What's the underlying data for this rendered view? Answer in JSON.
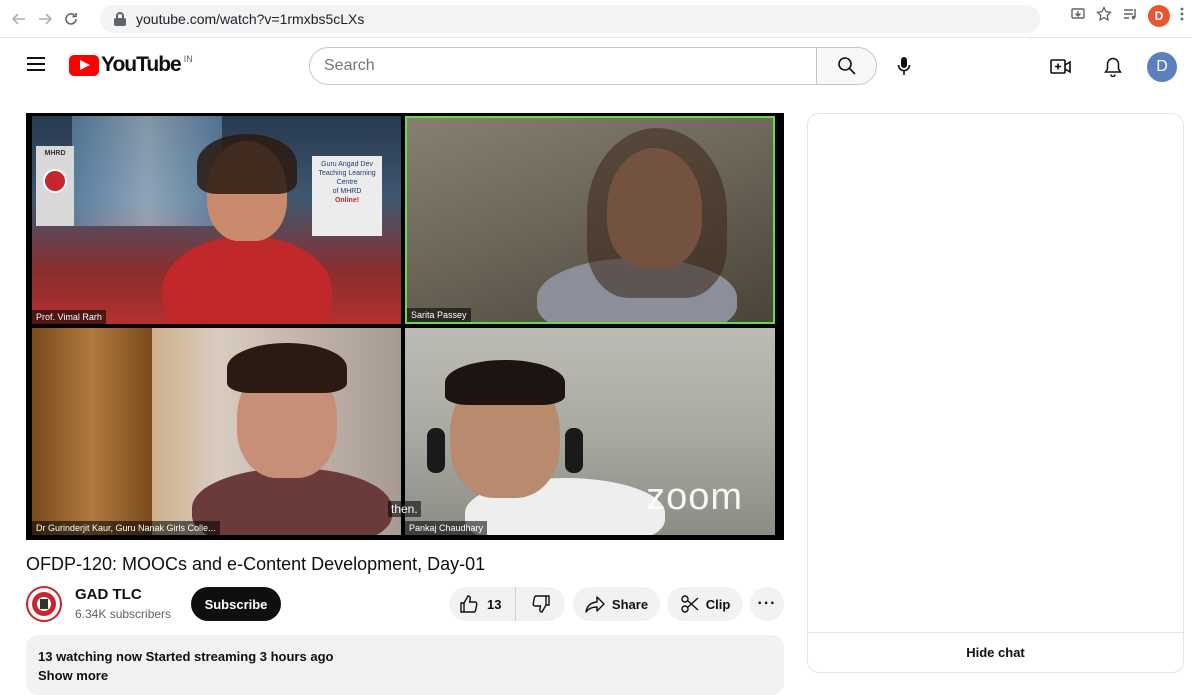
{
  "browser": {
    "url": "youtube.com/watch?v=1rmxbs5cLXs",
    "profile_initial": "D"
  },
  "header": {
    "logo_text": "YouTube",
    "country": "IN",
    "search_placeholder": "Search",
    "avatar_initial": "D"
  },
  "video": {
    "participants": [
      "Prof. Vimal Rarh",
      "Sarita Passey",
      "Dr Gurinderjit Kaur, Guru Nanak Girls Colle...",
      "Pankaj Chaudhary"
    ],
    "caption": "then.",
    "watermark": "zoom",
    "banner_lines": [
      "Guru Angad Dev",
      "Teaching Learning",
      "Centre",
      "of MHRD",
      "Online!"
    ],
    "banner_logo": "MHRD"
  },
  "title": "OFDP-120: MOOCs and e-Content Development, Day-01",
  "channel": {
    "name": "GAD TLC",
    "subscribers": "6.34K subscribers",
    "subscribe_label": "Subscribe"
  },
  "actions": {
    "likes": "13",
    "share_label": "Share",
    "clip_label": "Clip",
    "more_label": "···"
  },
  "description": {
    "stats": "13 watching now  Started streaming 3 hours ago",
    "show_more": "Show more"
  },
  "chat": {
    "hide_label": "Hide chat"
  },
  "colors": {
    "brand_red": "#ff0000",
    "active_speaker": "#6ed64a",
    "subscribe_bg": "#0f0f0f"
  }
}
